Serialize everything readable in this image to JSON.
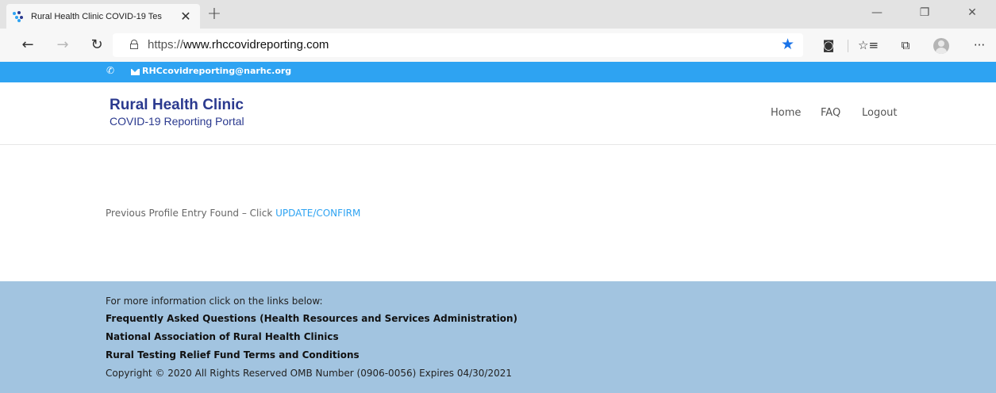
{
  "browser": {
    "tab_title": "Rural Health Clinic COVID-19 Tes",
    "tab_close": "✕",
    "new_tab": "+",
    "url_protocol": "https://",
    "url_host": "www.rhccovidreporting.com",
    "window": {
      "minimize": "—",
      "restore": "❐",
      "close": "✕"
    },
    "nav": {
      "back": "←",
      "forward": "→",
      "refresh": "↻"
    },
    "toolbar": {
      "favorite": "★",
      "extension": "◙",
      "favorites_list": "☆≡",
      "collections": "⧉",
      "more": "···"
    }
  },
  "contact_bar": {
    "email": "RHCcovidreporting@narhc.org",
    "background": "#2ea3f2"
  },
  "header": {
    "title": "Rural Health Clinic",
    "subtitle": "COVID-19 Reporting Portal",
    "nav": [
      "Home",
      "FAQ",
      "Logout"
    ],
    "title_color": "#2b3a8f"
  },
  "main": {
    "notice_text": "Previous Profile Entry Found – Click ",
    "notice_link": "UPDATE/CONFIRM",
    "link_color": "#2ea3f2"
  },
  "footer": {
    "intro": "For more information click on the links below:",
    "links": [
      "Frequently Asked Questions (Health Resources and Services Administration)",
      "National Association of Rural Health Clinics",
      "Rural Testing Relief Fund Terms and Conditions"
    ],
    "copyright": "Copyright © 2020 All Rights Reserved OMB Number (0906-0056) Expires 04/30/2021",
    "background": "#a2c4e0"
  }
}
